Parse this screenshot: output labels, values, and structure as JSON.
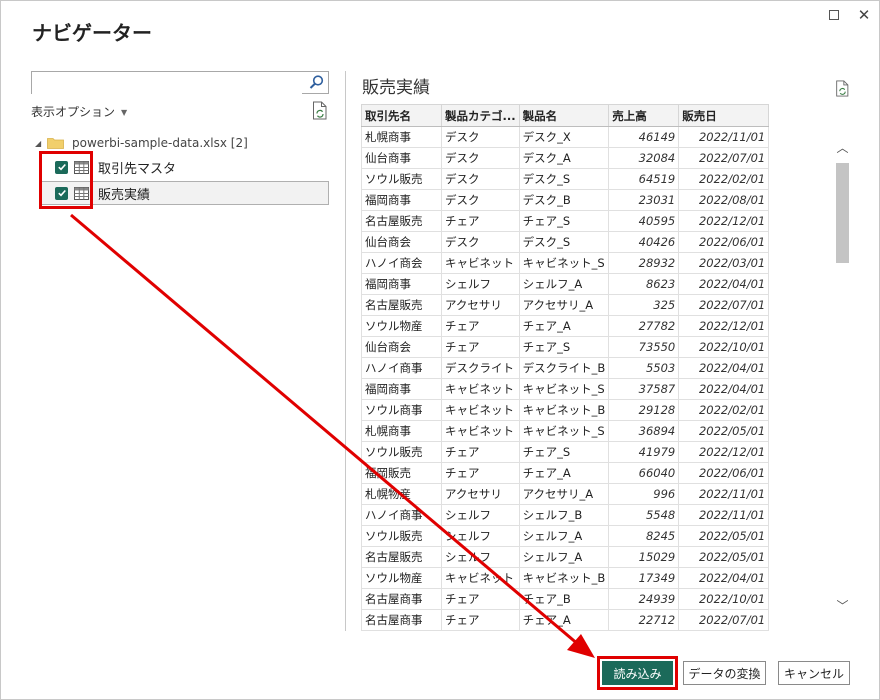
{
  "dialog": {
    "title": "ナビゲーター"
  },
  "left": {
    "search": {
      "value": "",
      "placeholder": ""
    },
    "options_label": "表示オプション",
    "tree": {
      "root": "powerbi-sample-data.xlsx [2]",
      "items": [
        {
          "label": "取引先マスタ",
          "checked": true
        },
        {
          "label": "販売実績",
          "checked": true,
          "selected": true
        }
      ]
    }
  },
  "preview": {
    "title": "販売実績",
    "columns": [
      "取引先名",
      "製品カテゴ...",
      "製品名",
      "売上高",
      "販売日"
    ],
    "rows": [
      [
        "札幌商事",
        "デスク",
        "デスク_X",
        "46149",
        "2022/11/01"
      ],
      [
        "仙台商事",
        "デスク",
        "デスク_A",
        "32084",
        "2022/07/01"
      ],
      [
        "ソウル販売",
        "デスク",
        "デスク_S",
        "64519",
        "2022/02/01"
      ],
      [
        "福岡商事",
        "デスク",
        "デスク_B",
        "23031",
        "2022/08/01"
      ],
      [
        "名古屋販売",
        "チェア",
        "チェア_S",
        "40595",
        "2022/12/01"
      ],
      [
        "仙台商会",
        "デスク",
        "デスク_S",
        "40426",
        "2022/06/01"
      ],
      [
        "ハノイ商会",
        "キャビネット",
        "キャビネット_S",
        "28932",
        "2022/03/01"
      ],
      [
        "福岡商事",
        "シェルフ",
        "シェルフ_A",
        "8623",
        "2022/04/01"
      ],
      [
        "名古屋販売",
        "アクセサリ",
        "アクセサリ_A",
        "325",
        "2022/07/01"
      ],
      [
        "ソウル物産",
        "チェア",
        "チェア_A",
        "27782",
        "2022/12/01"
      ],
      [
        "仙台商会",
        "チェア",
        "チェア_S",
        "73550",
        "2022/10/01"
      ],
      [
        "ハノイ商事",
        "デスクライト",
        "デスクライト_B",
        "5503",
        "2022/04/01"
      ],
      [
        "福岡商事",
        "キャビネット",
        "キャビネット_S",
        "37587",
        "2022/04/01"
      ],
      [
        "ソウル商事",
        "キャビネット",
        "キャビネット_B",
        "29128",
        "2022/02/01"
      ],
      [
        "札幌商事",
        "キャビネット",
        "キャビネット_S",
        "36894",
        "2022/05/01"
      ],
      [
        "ソウル販売",
        "チェア",
        "チェア_S",
        "41979",
        "2022/12/01"
      ],
      [
        "福岡販売",
        "チェア",
        "チェア_A",
        "66040",
        "2022/06/01"
      ],
      [
        "札幌物産",
        "アクセサリ",
        "アクセサリ_A",
        "996",
        "2022/11/01"
      ],
      [
        "ハノイ商事",
        "シェルフ",
        "シェルフ_B",
        "5548",
        "2022/11/01"
      ],
      [
        "ソウル販売",
        "シェルフ",
        "シェルフ_A",
        "8245",
        "2022/05/01"
      ],
      [
        "名古屋販売",
        "シェルフ",
        "シェルフ_A",
        "15029",
        "2022/05/01"
      ],
      [
        "ソウル物産",
        "キャビネット",
        "キャビネット_B",
        "17349",
        "2022/04/01"
      ],
      [
        "名古屋商事",
        "チェア",
        "チェア_B",
        "24939",
        "2022/10/01"
      ],
      [
        "名古屋商事",
        "チェア",
        "チェア_A",
        "22712",
        "2022/07/01"
      ]
    ]
  },
  "buttons": {
    "load": "読み込み",
    "transform": "データの変換",
    "cancel": "キャンセル"
  },
  "colors": {
    "accent": "#1b6a5a",
    "annotation": "#e00000"
  }
}
